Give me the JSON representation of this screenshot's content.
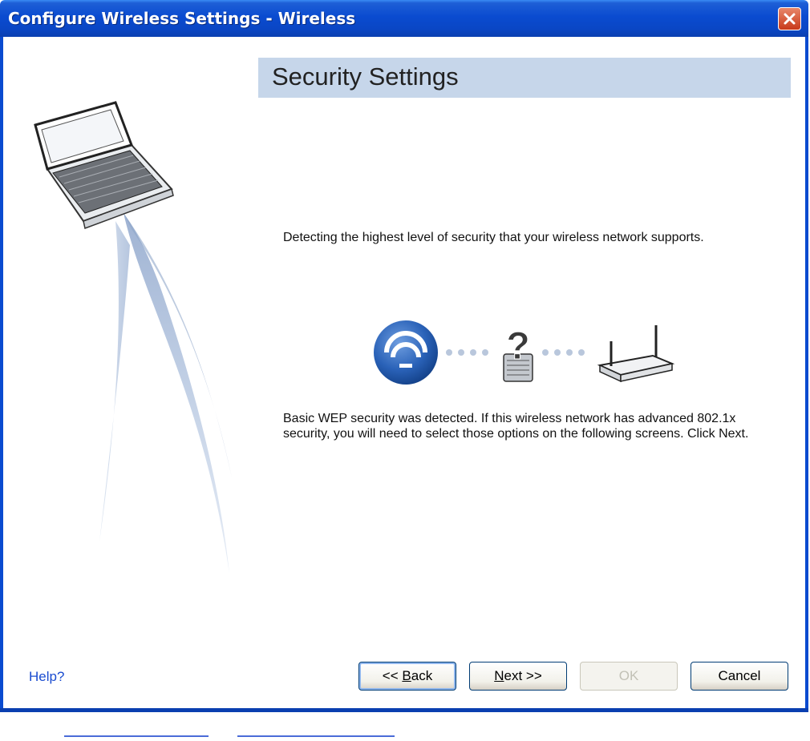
{
  "window": {
    "title": "Configure Wireless Settings - Wireless"
  },
  "header": {
    "title": "Security Settings"
  },
  "content": {
    "detecting_text": "Detecting the highest level of security that your wireless network supports.",
    "result_text": "Basic WEP security was detected. If this wireless network has advanced 802.1x security, you will need to select those options on the following screens. Click Next."
  },
  "graphic": {
    "icons": [
      "wireless-signal-icon",
      "lock-question-icon",
      "router-icon"
    ],
    "question_mark": "?"
  },
  "footer": {
    "help_label": "Help?",
    "back_label": "<< Back",
    "next_label": "Next >>",
    "ok_label": "OK",
    "cancel_label": "Cancel"
  },
  "colors": {
    "titlebar": "#0a4bd0",
    "header_band": "#c6d6ea",
    "help_link": "#1a4cd0",
    "close_button": "#c8391a"
  }
}
